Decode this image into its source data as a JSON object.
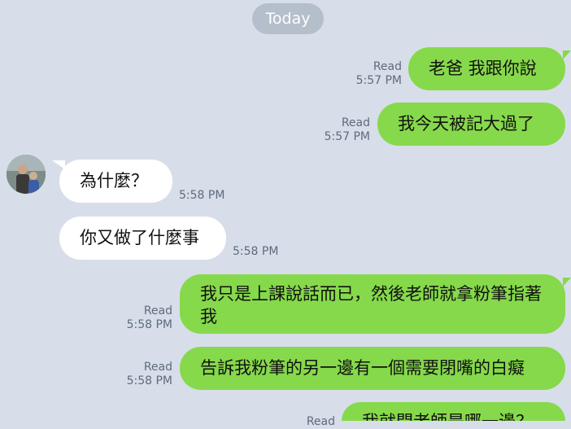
{
  "date_label": "Today",
  "messages": [
    {
      "text": "老爸 我跟你說",
      "read": "Read",
      "time": "5:57 PM"
    },
    {
      "text": "我今天被記大過了",
      "read": "Read",
      "time": "5:57 PM"
    },
    {
      "text": "為什麼？",
      "time": "5:58 PM"
    },
    {
      "text": "你又做了什麼事",
      "time": "5:58 PM"
    },
    {
      "text": "我只是上課說話而已，然後老師就拿粉筆指著我",
      "read": "Read",
      "time": "5:58 PM"
    },
    {
      "text": "告訴我粉筆的另一邊有一個需要閉嘴的白癡",
      "read": "Read",
      "time": "5:58 PM"
    },
    {
      "text": "我就問老師是哪一邊？",
      "read": "Read"
    }
  ],
  "colors": {
    "background": "#d7dee9",
    "outgoing_bubble": "#86d94a",
    "incoming_bubble": "#ffffff",
    "date_pill": "#b5bfcb"
  },
  "avatar": {
    "icon": "contact-photo-icon"
  }
}
